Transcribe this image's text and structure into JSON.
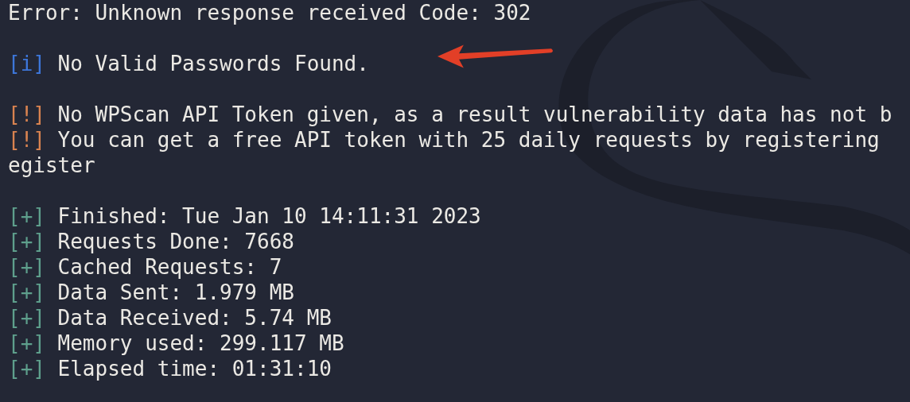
{
  "terminal": {
    "lines": [
      {
        "kind": "plain",
        "text": "Error: Unknown response received Code: 302"
      },
      {
        "kind": "blank"
      },
      {
        "kind": "info",
        "tag": "[i]",
        "text": "No Valid Passwords Found."
      },
      {
        "kind": "blank"
      },
      {
        "kind": "warn",
        "tag": "[!]",
        "text": "No WPScan API Token given, as a result vulnerability data has not b"
      },
      {
        "kind": "warn",
        "tag": "[!]",
        "text": "You can get a free API token with 25 daily requests by registering"
      },
      {
        "kind": "plain",
        "text": "egister"
      },
      {
        "kind": "blank"
      },
      {
        "kind": "plus",
        "tag": "[+]",
        "text": "Finished: Tue Jan 10 14:11:31 2023"
      },
      {
        "kind": "plus",
        "tag": "[+]",
        "text": "Requests Done: 7668"
      },
      {
        "kind": "plus",
        "tag": "[+]",
        "text": "Cached Requests: 7"
      },
      {
        "kind": "plus",
        "tag": "[+]",
        "text": "Data Sent: 1.979 MB"
      },
      {
        "kind": "plus",
        "tag": "[+]",
        "text": "Data Received: 5.74 MB"
      },
      {
        "kind": "plus",
        "tag": "[+]",
        "text": "Memory used: 299.117 MB"
      },
      {
        "kind": "plus",
        "tag": "[+]",
        "text": "Elapsed time: 01:31:10"
      }
    ]
  }
}
